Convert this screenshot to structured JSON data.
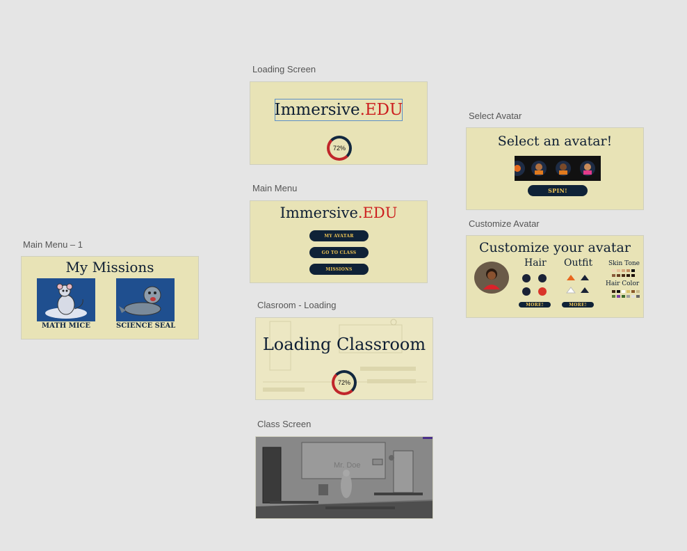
{
  "labels": {
    "loading": "Loading Screen",
    "main_menu": "Main Menu",
    "main_menu_1": "Main Menu – 1",
    "classroom_loading": "Clasroom - Loading",
    "class_screen": "Class Screen",
    "select_avatar": "Select Avatar",
    "customize_avatar": "Customize Avatar"
  },
  "loading": {
    "brand_main": "Immersive",
    "brand_dot": ".",
    "brand_edu": "EDU",
    "progress_label": "72%",
    "progress": 0.72
  },
  "main_menu": {
    "brand_main": "Immersive",
    "brand_dot": ".",
    "brand_edu": "EDU",
    "buttons": [
      "MY AVATAR",
      "GO TO CLASS",
      "MISSIONS"
    ]
  },
  "missions": {
    "title": "My Missions",
    "cards": [
      "MATH MICE",
      "SCIENCE SEAL"
    ]
  },
  "classroom_loading": {
    "title": "Loading Classroom",
    "progress_label": "72%",
    "progress": 0.72
  },
  "class_screen": {
    "board_text": "Mr. Doe"
  },
  "select_avatar": {
    "title": "Select an avatar!",
    "spin_label": "SPIN!"
  },
  "customize_avatar": {
    "title": "Customize your avatar",
    "hair_label": "Hair",
    "outfit_label": "Outfit",
    "skin_label": "Skin Tone",
    "hair_color_label": "Hair Color",
    "more_label": "MORE!",
    "skin_colors": [
      "#f3d6b8",
      "#e8bf98",
      "#d7a67c",
      "#c08a5e",
      "#111111",
      "#8b5a3c",
      "#6b3f24",
      "#4a2a16",
      "#2d1a0f",
      "#1a0f08"
    ],
    "hair_colors": [
      "#3a2414",
      "#111111",
      "#ffffff",
      "#d9c36a",
      "#8a5a2b",
      "#c8b98a",
      "#5b7f3a",
      "#7b3fa8",
      "#3d6b2e",
      "#9e9e9e",
      "#e0e0e0",
      "#666666"
    ]
  },
  "colors": {
    "artboard_bg": "#e8e3b6",
    "navy": "#0f2237",
    "accent_red": "#cc1f1f",
    "button_text": "#f1c654"
  }
}
